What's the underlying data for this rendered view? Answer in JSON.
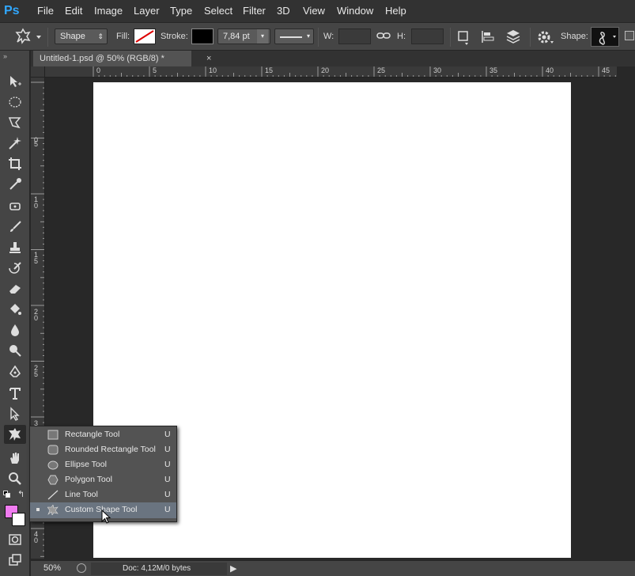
{
  "app": {
    "logo": "Ps"
  },
  "menu": [
    "File",
    "Edit",
    "Image",
    "Layer",
    "Type",
    "Select",
    "Filter",
    "3D",
    "View",
    "Window",
    "Help"
  ],
  "options": {
    "mode_value": "Shape",
    "fill_label": "Fill:",
    "stroke_label": "Stroke:",
    "stroke_width": "7,84 pt",
    "w_label": "W:",
    "h_label": "H:",
    "shape_label": "Shape:"
  },
  "document": {
    "tab_title": "Untitled-1.psd @ 50% (RGB/8) *",
    "tab_close": "×"
  },
  "ruler": {
    "top_labels": [
      "0",
      "5",
      "10",
      "15",
      "20",
      "25",
      "30",
      "35",
      "40",
      "45"
    ],
    "left_labels": [
      "0",
      "5",
      "1 0",
      "1 5",
      "2 0",
      "2 5",
      "3 0",
      "3 5",
      "4 0"
    ]
  },
  "flyout": {
    "items": [
      {
        "label": "Rectangle Tool",
        "key": "U",
        "icon": "rectangle-icon"
      },
      {
        "label": "Rounded Rectangle Tool",
        "key": "U",
        "icon": "rounded-rectangle-icon"
      },
      {
        "label": "Ellipse Tool",
        "key": "U",
        "icon": "ellipse-icon"
      },
      {
        "label": "Polygon Tool",
        "key": "U",
        "icon": "polygon-icon"
      },
      {
        "label": "Line Tool",
        "key": "U",
        "icon": "line-icon"
      },
      {
        "label": "Custom Shape Tool",
        "key": "U",
        "icon": "custom-shape-icon",
        "selected": true
      }
    ]
  },
  "status": {
    "zoom": "50%",
    "doc_info": "Doc: 4,12M/0 bytes",
    "arrow": "▶"
  },
  "colors": {
    "foreground": "#f07cf0",
    "background": "#ffffff",
    "logo": "#31a8ff"
  }
}
